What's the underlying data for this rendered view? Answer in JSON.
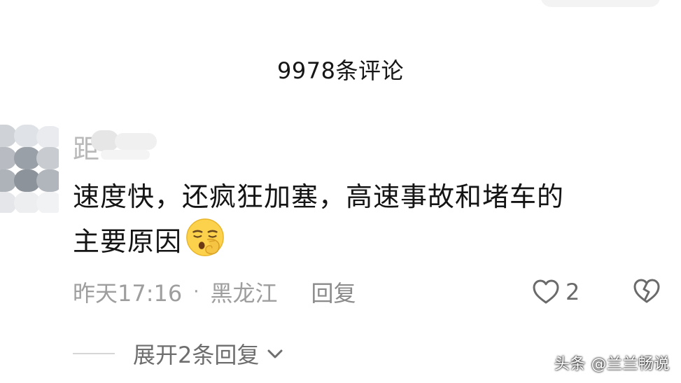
{
  "header": {
    "title": "9978条评论"
  },
  "comment": {
    "username_glyph": "距",
    "text_line1": "速度快，还疯狂加塞，高速事故和堵车的",
    "text_line2": "主要原因",
    "emoji_icon": "shushing-face-emoji",
    "time": "昨天17:16",
    "separator": "·",
    "location": "黑龙江",
    "reply_label": "回复",
    "likes": "2"
  },
  "replies": {
    "expand_label": "展开2条回复"
  },
  "watermark": "头条 @兰兰畅说",
  "colors": {
    "text_primary": "#141414",
    "text_meta": "#9e9e9e",
    "icon_gray": "#6a6a6a"
  }
}
